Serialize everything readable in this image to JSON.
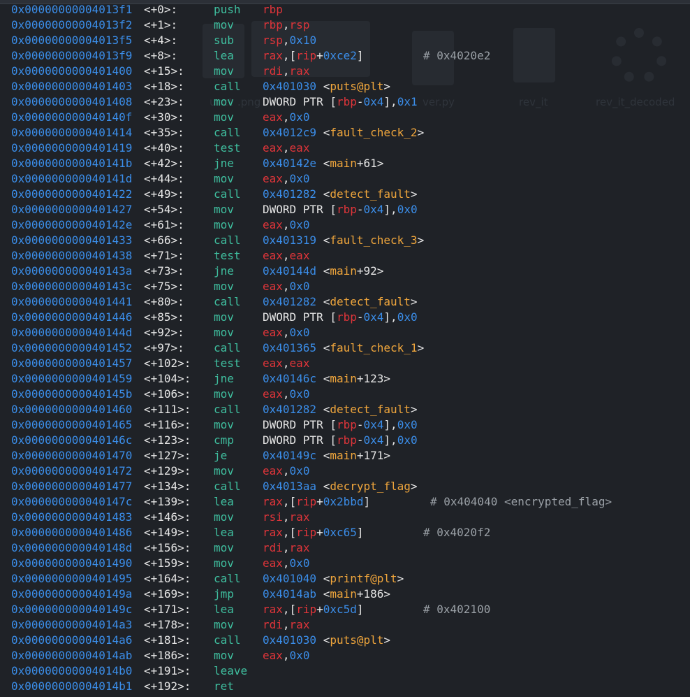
{
  "ghost": {
    "labels": [
      "unct",
      ".png",
      "ver.py",
      "rev_it",
      "rev_it_decoded"
    ]
  },
  "lines": [
    {
      "addr": "0x00000000004013f1",
      "off": "<+0>:",
      "mnem": "push",
      "ops": [
        {
          "t": "rbp",
          "k": "reg"
        }
      ]
    },
    {
      "addr": "0x00000000004013f2",
      "off": "<+1>:",
      "mnem": "mov",
      "ops": [
        {
          "t": "rbp",
          "k": "reg"
        },
        {
          "t": ",",
          "k": "plain"
        },
        {
          "t": "rsp",
          "k": "reg"
        }
      ]
    },
    {
      "addr": "0x00000000004013f5",
      "off": "<+4>:",
      "mnem": "sub",
      "ops": [
        {
          "t": "rsp",
          "k": "reg"
        },
        {
          "t": ",",
          "k": "plain"
        },
        {
          "t": "0x10",
          "k": "num"
        }
      ]
    },
    {
      "addr": "0x00000000004013f9",
      "off": "<+8>:",
      "mnem": "lea",
      "ops": [
        {
          "t": "rax",
          "k": "reg"
        },
        {
          "t": ",[",
          "k": "plain"
        },
        {
          "t": "rip",
          "k": "reg"
        },
        {
          "t": "+",
          "k": "plain"
        },
        {
          "t": "0xce2",
          "k": "num"
        },
        {
          "t": "]",
          "k": "plain"
        }
      ],
      "comment": "# 0x4020e2",
      "cpos": 590
    },
    {
      "addr": "0x0000000000401400",
      "off": "<+15>:",
      "mnem": "mov",
      "ops": [
        {
          "t": "rdi",
          "k": "reg"
        },
        {
          "t": ",",
          "k": "plain"
        },
        {
          "t": "rax",
          "k": "reg"
        }
      ]
    },
    {
      "addr": "0x0000000000401403",
      "off": "<+18>:",
      "mnem": "call",
      "ops": [
        {
          "t": "0x401030",
          "k": "num"
        },
        {
          "t": " <",
          "k": "plain"
        },
        {
          "t": "puts@plt",
          "k": "sym"
        },
        {
          "t": ">",
          "k": "plain"
        }
      ]
    },
    {
      "addr": "0x0000000000401408",
      "off": "<+23>:",
      "mnem": "mov",
      "ops": [
        {
          "t": "DWORD PTR [",
          "k": "plain"
        },
        {
          "t": "rbp",
          "k": "reg"
        },
        {
          "t": "-",
          "k": "plain"
        },
        {
          "t": "0x4",
          "k": "num"
        },
        {
          "t": "],",
          "k": "plain"
        },
        {
          "t": "0x1",
          "k": "num"
        }
      ]
    },
    {
      "addr": "0x000000000040140f",
      "off": "<+30>:",
      "mnem": "mov",
      "ops": [
        {
          "t": "eax",
          "k": "reg"
        },
        {
          "t": ",",
          "k": "plain"
        },
        {
          "t": "0x0",
          "k": "num"
        }
      ]
    },
    {
      "addr": "0x0000000000401414",
      "off": "<+35>:",
      "mnem": "call",
      "ops": [
        {
          "t": "0x4012c9",
          "k": "num"
        },
        {
          "t": " <",
          "k": "plain"
        },
        {
          "t": "fault_check_2",
          "k": "sym"
        },
        {
          "t": ">",
          "k": "plain"
        }
      ]
    },
    {
      "addr": "0x0000000000401419",
      "off": "<+40>:",
      "mnem": "test",
      "ops": [
        {
          "t": "eax",
          "k": "reg"
        },
        {
          "t": ",",
          "k": "plain"
        },
        {
          "t": "eax",
          "k": "reg"
        }
      ]
    },
    {
      "addr": "0x000000000040141b",
      "off": "<+42>:",
      "mnem": "jne",
      "ops": [
        {
          "t": "0x40142e",
          "k": "num"
        },
        {
          "t": " <",
          "k": "plain"
        },
        {
          "t": "main",
          "k": "sym"
        },
        {
          "t": "+61>",
          "k": "plain"
        }
      ]
    },
    {
      "addr": "0x000000000040141d",
      "off": "<+44>:",
      "mnem": "mov",
      "ops": [
        {
          "t": "eax",
          "k": "reg"
        },
        {
          "t": ",",
          "k": "plain"
        },
        {
          "t": "0x0",
          "k": "num"
        }
      ]
    },
    {
      "addr": "0x0000000000401422",
      "off": "<+49>:",
      "mnem": "call",
      "ops": [
        {
          "t": "0x401282",
          "k": "num"
        },
        {
          "t": " <",
          "k": "plain"
        },
        {
          "t": "detect_fault",
          "k": "sym"
        },
        {
          "t": ">",
          "k": "plain"
        }
      ]
    },
    {
      "addr": "0x0000000000401427",
      "off": "<+54>:",
      "mnem": "mov",
      "ops": [
        {
          "t": "DWORD PTR [",
          "k": "plain"
        },
        {
          "t": "rbp",
          "k": "reg"
        },
        {
          "t": "-",
          "k": "plain"
        },
        {
          "t": "0x4",
          "k": "num"
        },
        {
          "t": "],",
          "k": "plain"
        },
        {
          "t": "0x0",
          "k": "num"
        }
      ]
    },
    {
      "addr": "0x000000000040142e",
      "off": "<+61>:",
      "mnem": "mov",
      "ops": [
        {
          "t": "eax",
          "k": "reg"
        },
        {
          "t": ",",
          "k": "plain"
        },
        {
          "t": "0x0",
          "k": "num"
        }
      ]
    },
    {
      "addr": "0x0000000000401433",
      "off": "<+66>:",
      "mnem": "call",
      "ops": [
        {
          "t": "0x401319",
          "k": "num"
        },
        {
          "t": " <",
          "k": "plain"
        },
        {
          "t": "fault_check_3",
          "k": "sym"
        },
        {
          "t": ">",
          "k": "plain"
        }
      ]
    },
    {
      "addr": "0x0000000000401438",
      "off": "<+71>:",
      "mnem": "test",
      "ops": [
        {
          "t": "eax",
          "k": "reg"
        },
        {
          "t": ",",
          "k": "plain"
        },
        {
          "t": "eax",
          "k": "reg"
        }
      ]
    },
    {
      "addr": "0x000000000040143a",
      "off": "<+73>:",
      "mnem": "jne",
      "ops": [
        {
          "t": "0x40144d",
          "k": "num"
        },
        {
          "t": " <",
          "k": "plain"
        },
        {
          "t": "main",
          "k": "sym"
        },
        {
          "t": "+92>",
          "k": "plain"
        }
      ]
    },
    {
      "addr": "0x000000000040143c",
      "off": "<+75>:",
      "mnem": "mov",
      "ops": [
        {
          "t": "eax",
          "k": "reg"
        },
        {
          "t": ",",
          "k": "plain"
        },
        {
          "t": "0x0",
          "k": "num"
        }
      ]
    },
    {
      "addr": "0x0000000000401441",
      "off": "<+80>:",
      "mnem": "call",
      "ops": [
        {
          "t": "0x401282",
          "k": "num"
        },
        {
          "t": " <",
          "k": "plain"
        },
        {
          "t": "detect_fault",
          "k": "sym"
        },
        {
          "t": ">",
          "k": "plain"
        }
      ]
    },
    {
      "addr": "0x0000000000401446",
      "off": "<+85>:",
      "mnem": "mov",
      "ops": [
        {
          "t": "DWORD PTR [",
          "k": "plain"
        },
        {
          "t": "rbp",
          "k": "reg"
        },
        {
          "t": "-",
          "k": "plain"
        },
        {
          "t": "0x4",
          "k": "num"
        },
        {
          "t": "],",
          "k": "plain"
        },
        {
          "t": "0x0",
          "k": "num"
        }
      ]
    },
    {
      "addr": "0x000000000040144d",
      "off": "<+92>:",
      "mnem": "mov",
      "ops": [
        {
          "t": "eax",
          "k": "reg"
        },
        {
          "t": ",",
          "k": "plain"
        },
        {
          "t": "0x0",
          "k": "num"
        }
      ]
    },
    {
      "addr": "0x0000000000401452",
      "off": "<+97>:",
      "mnem": "call",
      "ops": [
        {
          "t": "0x401365",
          "k": "num"
        },
        {
          "t": " <",
          "k": "plain"
        },
        {
          "t": "fault_check_1",
          "k": "sym"
        },
        {
          "t": ">",
          "k": "plain"
        }
      ]
    },
    {
      "addr": "0x0000000000401457",
      "off": "<+102>:",
      "mnem": "test",
      "ops": [
        {
          "t": "eax",
          "k": "reg"
        },
        {
          "t": ",",
          "k": "plain"
        },
        {
          "t": "eax",
          "k": "reg"
        }
      ]
    },
    {
      "addr": "0x0000000000401459",
      "off": "<+104>:",
      "mnem": "jne",
      "ops": [
        {
          "t": "0x40146c",
          "k": "num"
        },
        {
          "t": " <",
          "k": "plain"
        },
        {
          "t": "main",
          "k": "sym"
        },
        {
          "t": "+123>",
          "k": "plain"
        }
      ]
    },
    {
      "addr": "0x000000000040145b",
      "off": "<+106>:",
      "mnem": "mov",
      "ops": [
        {
          "t": "eax",
          "k": "reg"
        },
        {
          "t": ",",
          "k": "plain"
        },
        {
          "t": "0x0",
          "k": "num"
        }
      ]
    },
    {
      "addr": "0x0000000000401460",
      "off": "<+111>:",
      "mnem": "call",
      "ops": [
        {
          "t": "0x401282",
          "k": "num"
        },
        {
          "t": " <",
          "k": "plain"
        },
        {
          "t": "detect_fault",
          "k": "sym"
        },
        {
          "t": ">",
          "k": "plain"
        }
      ]
    },
    {
      "addr": "0x0000000000401465",
      "off": "<+116>:",
      "mnem": "mov",
      "ops": [
        {
          "t": "DWORD PTR [",
          "k": "plain"
        },
        {
          "t": "rbp",
          "k": "reg"
        },
        {
          "t": "-",
          "k": "plain"
        },
        {
          "t": "0x4",
          "k": "num"
        },
        {
          "t": "],",
          "k": "plain"
        },
        {
          "t": "0x0",
          "k": "num"
        }
      ]
    },
    {
      "addr": "0x000000000040146c",
      "off": "<+123>:",
      "mnem": "cmp",
      "ops": [
        {
          "t": "DWORD PTR [",
          "k": "plain"
        },
        {
          "t": "rbp",
          "k": "reg"
        },
        {
          "t": "-",
          "k": "plain"
        },
        {
          "t": "0x4",
          "k": "num"
        },
        {
          "t": "],",
          "k": "plain"
        },
        {
          "t": "0x0",
          "k": "num"
        }
      ]
    },
    {
      "addr": "0x0000000000401470",
      "off": "<+127>:",
      "mnem": "je",
      "ops": [
        {
          "t": "0x40149c",
          "k": "num"
        },
        {
          "t": " <",
          "k": "plain"
        },
        {
          "t": "main",
          "k": "sym"
        },
        {
          "t": "+171>",
          "k": "plain"
        }
      ]
    },
    {
      "addr": "0x0000000000401472",
      "off": "<+129>:",
      "mnem": "mov",
      "ops": [
        {
          "t": "eax",
          "k": "reg"
        },
        {
          "t": ",",
          "k": "plain"
        },
        {
          "t": "0x0",
          "k": "num"
        }
      ]
    },
    {
      "addr": "0x0000000000401477",
      "off": "<+134>:",
      "mnem": "call",
      "ops": [
        {
          "t": "0x4013aa",
          "k": "num"
        },
        {
          "t": " <",
          "k": "plain"
        },
        {
          "t": "decrypt_flag",
          "k": "sym"
        },
        {
          "t": ">",
          "k": "plain"
        }
      ]
    },
    {
      "addr": "0x000000000040147c",
      "off": "<+139>:",
      "mnem": "lea",
      "ops": [
        {
          "t": "rax",
          "k": "reg"
        },
        {
          "t": ",[",
          "k": "plain"
        },
        {
          "t": "rip",
          "k": "reg"
        },
        {
          "t": "+",
          "k": "plain"
        },
        {
          "t": "0x2bbd",
          "k": "num"
        },
        {
          "t": "]",
          "k": "plain"
        }
      ],
      "comment": "# 0x404040 <encrypted_flag>",
      "cpos": 600
    },
    {
      "addr": "0x0000000000401483",
      "off": "<+146>:",
      "mnem": "mov",
      "ops": [
        {
          "t": "rsi",
          "k": "reg"
        },
        {
          "t": ",",
          "k": "plain"
        },
        {
          "t": "rax",
          "k": "reg"
        }
      ]
    },
    {
      "addr": "0x0000000000401486",
      "off": "<+149>:",
      "mnem": "lea",
      "ops": [
        {
          "t": "rax",
          "k": "reg"
        },
        {
          "t": ",[",
          "k": "plain"
        },
        {
          "t": "rip",
          "k": "reg"
        },
        {
          "t": "+",
          "k": "plain"
        },
        {
          "t": "0xc65",
          "k": "num"
        },
        {
          "t": "]",
          "k": "plain"
        }
      ],
      "comment": "# 0x4020f2",
      "cpos": 590
    },
    {
      "addr": "0x000000000040148d",
      "off": "<+156>:",
      "mnem": "mov",
      "ops": [
        {
          "t": "rdi",
          "k": "reg"
        },
        {
          "t": ",",
          "k": "plain"
        },
        {
          "t": "rax",
          "k": "reg"
        }
      ]
    },
    {
      "addr": "0x0000000000401490",
      "off": "<+159>:",
      "mnem": "mov",
      "ops": [
        {
          "t": "eax",
          "k": "reg"
        },
        {
          "t": ",",
          "k": "plain"
        },
        {
          "t": "0x0",
          "k": "num"
        }
      ]
    },
    {
      "addr": "0x0000000000401495",
      "off": "<+164>:",
      "mnem": "call",
      "ops": [
        {
          "t": "0x401040",
          "k": "num"
        },
        {
          "t": " <",
          "k": "plain"
        },
        {
          "t": "printf@plt",
          "k": "sym"
        },
        {
          "t": ">",
          "k": "plain"
        }
      ]
    },
    {
      "addr": "0x000000000040149a",
      "off": "<+169>:",
      "mnem": "jmp",
      "ops": [
        {
          "t": "0x4014ab",
          "k": "num"
        },
        {
          "t": " <",
          "k": "plain"
        },
        {
          "t": "main",
          "k": "sym"
        },
        {
          "t": "+186>",
          "k": "plain"
        }
      ]
    },
    {
      "addr": "0x000000000040149c",
      "off": "<+171>:",
      "mnem": "lea",
      "ops": [
        {
          "t": "rax",
          "k": "reg"
        },
        {
          "t": ",[",
          "k": "plain"
        },
        {
          "t": "rip",
          "k": "reg"
        },
        {
          "t": "+",
          "k": "plain"
        },
        {
          "t": "0xc5d",
          "k": "num"
        },
        {
          "t": "]",
          "k": "plain"
        }
      ],
      "comment": "# 0x402100",
      "cpos": 590
    },
    {
      "addr": "0x00000000004014a3",
      "off": "<+178>:",
      "mnem": "mov",
      "ops": [
        {
          "t": "rdi",
          "k": "reg"
        },
        {
          "t": ",",
          "k": "plain"
        },
        {
          "t": "rax",
          "k": "reg"
        }
      ]
    },
    {
      "addr": "0x00000000004014a6",
      "off": "<+181>:",
      "mnem": "call",
      "ops": [
        {
          "t": "0x401030",
          "k": "num"
        },
        {
          "t": " <",
          "k": "plain"
        },
        {
          "t": "puts@plt",
          "k": "sym"
        },
        {
          "t": ">",
          "k": "plain"
        }
      ]
    },
    {
      "addr": "0x00000000004014ab",
      "off": "<+186>:",
      "mnem": "mov",
      "ops": [
        {
          "t": "eax",
          "k": "reg"
        },
        {
          "t": ",",
          "k": "plain"
        },
        {
          "t": "0x0",
          "k": "num"
        }
      ]
    },
    {
      "addr": "0x00000000004014b0",
      "off": "<+191>:",
      "mnem": "leave",
      "ops": []
    },
    {
      "addr": "0x00000000004014b1",
      "off": "<+192>:",
      "mnem": "ret",
      "ops": []
    }
  ]
}
